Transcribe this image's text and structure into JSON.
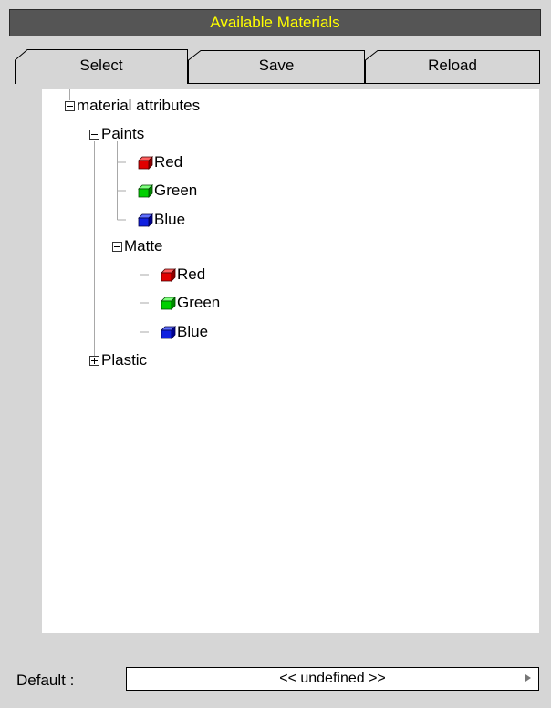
{
  "window": {
    "title": "Available Materials"
  },
  "tabs": [
    {
      "label": "Select",
      "active": true
    },
    {
      "label": "Save",
      "active": false
    },
    {
      "label": "Reload",
      "active": false
    }
  ],
  "tree": {
    "root": {
      "label": "material attributes",
      "expanded": true
    },
    "paints": {
      "label": "Paints",
      "expanded": true,
      "items": [
        {
          "label": "Red",
          "color": "#e00000",
          "icon": "red-cube-icon"
        },
        {
          "label": "Green",
          "color": "#00d000",
          "icon": "green-cube-icon"
        },
        {
          "label": "Blue",
          "color": "#1020e0",
          "icon": "blue-cube-icon"
        }
      ]
    },
    "matte": {
      "label": "Matte",
      "expanded": true,
      "items": [
        {
          "label": "Red",
          "color": "#e00000",
          "icon": "red-cube-icon"
        },
        {
          "label": "Green",
          "color": "#00d000",
          "icon": "green-cube-icon"
        },
        {
          "label": "Blue",
          "color": "#1020e0",
          "icon": "blue-cube-icon"
        }
      ]
    },
    "plastic": {
      "label": "Plastic",
      "expanded": false
    }
  },
  "footer": {
    "default_label": "Default :",
    "default_value": "<< undefined >>"
  },
  "colors": {
    "title_bg": "#555555",
    "title_text": "#ffff00",
    "panel_bg": "#d6d6d6"
  }
}
